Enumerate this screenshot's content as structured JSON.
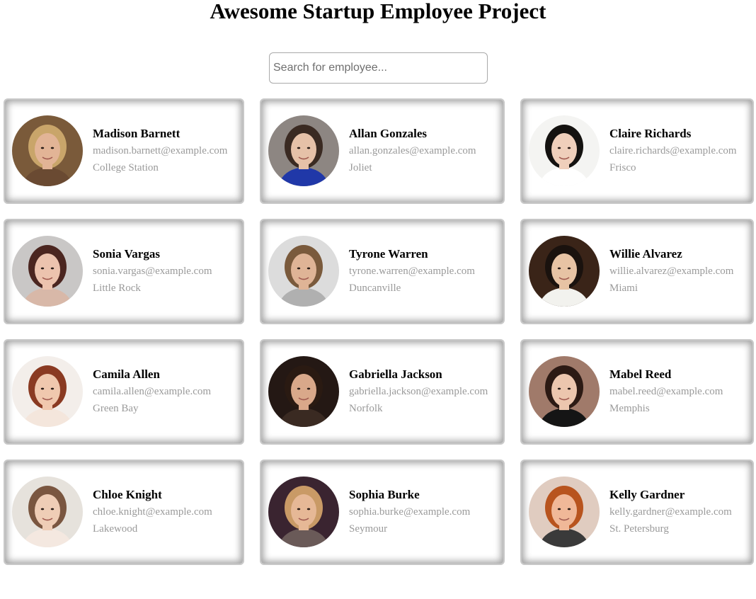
{
  "header": {
    "title": "Awesome Startup Employee Project"
  },
  "search": {
    "placeholder": "Search for employee...",
    "value": ""
  },
  "employees": [
    {
      "name": "Madison Barnett",
      "email": "madison.barnett@example.com",
      "city": "College Station",
      "photo": "portrait-photo",
      "colors": {
        "bg": "#7a5a3a",
        "hair": "#c9a56a",
        "skin": "#e2b496",
        "shirt": "#6a4a32"
      }
    },
    {
      "name": "Allan Gonzales",
      "email": "allan.gonzales@example.com",
      "city": "Joliet",
      "photo": "portrait-photo",
      "colors": {
        "bg": "#8d8682",
        "hair": "#3a2a22",
        "skin": "#e6c1a8",
        "shirt": "#2038a8"
      }
    },
    {
      "name": "Claire Richards",
      "email": "claire.richards@example.com",
      "city": "Frisco",
      "photo": "portrait-photo",
      "colors": {
        "bg": "#f4f4f2",
        "hair": "#141210",
        "skin": "#efcfbb",
        "shirt": "#ffffff"
      }
    },
    {
      "name": "Sonia Vargas",
      "email": "sonia.vargas@example.com",
      "city": "Little Rock",
      "photo": "portrait-photo",
      "colors": {
        "bg": "#c9c7c6",
        "hair": "#4b2620",
        "skin": "#ecc3ae",
        "shirt": "#d8b8a8"
      }
    },
    {
      "name": "Tyrone Warren",
      "email": "tyrone.warren@example.com",
      "city": "Duncanville",
      "photo": "portrait-photo",
      "colors": {
        "bg": "#dcdcdc",
        "hair": "#7a5a3c",
        "skin": "#dfb496",
        "shirt": "#b0b0b0"
      }
    },
    {
      "name": "Willie Alvarez",
      "email": "willie.alvarez@example.com",
      "city": "Miami",
      "photo": "portrait-photo",
      "colors": {
        "bg": "#3a2418",
        "hair": "#1a120e",
        "skin": "#e7c3a4",
        "shirt": "#f2f2ee"
      }
    },
    {
      "name": "Camila Allen",
      "email": "camila.allen@example.com",
      "city": "Green Bay",
      "photo": "portrait-photo",
      "colors": {
        "bg": "#f3eeea",
        "hair": "#8a3a22",
        "skin": "#f0c8ae",
        "shirt": "#f4e6dc"
      }
    },
    {
      "name": "Gabriella Jackson",
      "email": "gabriella.jackson@example.com",
      "city": "Norfolk",
      "photo": "portrait-photo",
      "colors": {
        "bg": "#241814",
        "hair": "#2a1a12",
        "skin": "#d9a88a",
        "shirt": "#3a2a22"
      }
    },
    {
      "name": "Mabel Reed",
      "email": "mabel.reed@example.com",
      "city": "Memphis",
      "photo": "portrait-photo",
      "colors": {
        "bg": "#a07a6a",
        "hair": "#2c1a14",
        "skin": "#ecc6ae",
        "shirt": "#151515"
      }
    },
    {
      "name": "Chloe Knight",
      "email": "chloe.knight@example.com",
      "city": "Lakewood",
      "photo": "portrait-photo",
      "colors": {
        "bg": "#e6e2dc",
        "hair": "#7a5640",
        "skin": "#efcdb6",
        "shirt": "#f4e8e0"
      }
    },
    {
      "name": "Sophia Burke",
      "email": "sophia.burke@example.com",
      "city": "Seymour",
      "photo": "portrait-photo",
      "colors": {
        "bg": "#3a2430",
        "hair": "#c99a66",
        "skin": "#e6b896",
        "shirt": "#6a5a58"
      }
    },
    {
      "name": "Kelly Gardner",
      "email": "kelly.gardner@example.com",
      "city": "St. Petersburg",
      "photo": "portrait-photo",
      "colors": {
        "bg": "#e0ccc0",
        "hair": "#b8541e",
        "skin": "#f0b898",
        "shirt": "#3a3a3a"
      }
    }
  ]
}
